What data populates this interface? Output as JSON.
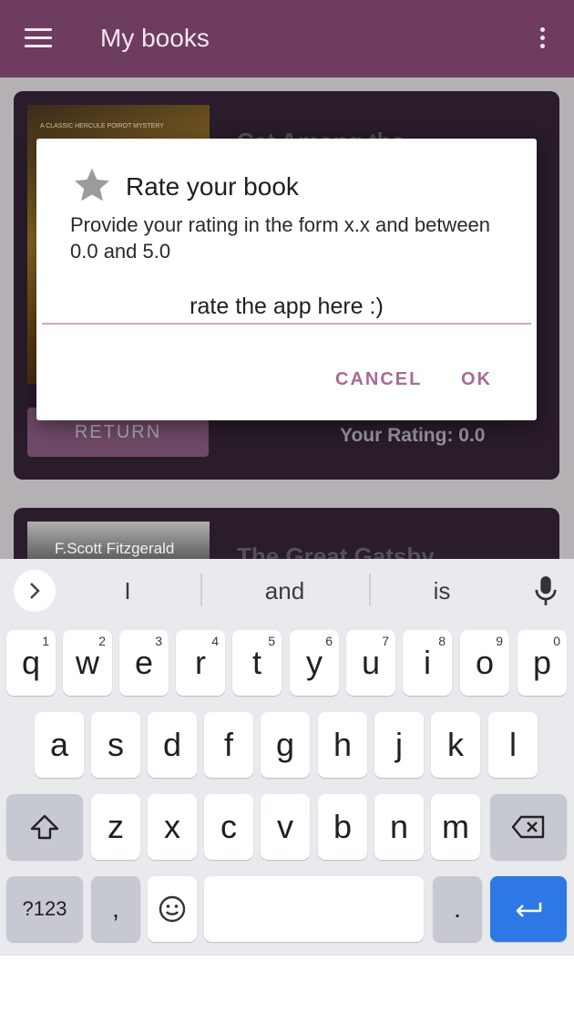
{
  "app_bar": {
    "title": "My books"
  },
  "books": [
    {
      "title": "Cat Among the",
      "cover_tag": "A CLASSIC HERCULE POIROT MYSTERY",
      "return_label": "RETURN",
      "rating_text": "Your Rating: 0.0"
    },
    {
      "title": "The Great Gatsby",
      "cover_author": "F.Scott Fitzgerald"
    }
  ],
  "dialog": {
    "icon": "star-icon",
    "title": "Rate your book",
    "message": "Provide your rating in the form x.x and between 0.0 and 5.0",
    "input_placeholder": "rate the app here :)",
    "cancel_label": "CANCEL",
    "ok_label": "OK"
  },
  "keyboard": {
    "suggestions": [
      "I",
      "and",
      "is"
    ],
    "row1": [
      {
        "key": "q",
        "hint": "1"
      },
      {
        "key": "w",
        "hint": "2"
      },
      {
        "key": "e",
        "hint": "3"
      },
      {
        "key": "r",
        "hint": "4"
      },
      {
        "key": "t",
        "hint": "5"
      },
      {
        "key": "y",
        "hint": "6"
      },
      {
        "key": "u",
        "hint": "7"
      },
      {
        "key": "i",
        "hint": "8"
      },
      {
        "key": "o",
        "hint": "9"
      },
      {
        "key": "p",
        "hint": "0"
      }
    ],
    "row2": [
      "a",
      "s",
      "d",
      "f",
      "g",
      "h",
      "j",
      "k",
      "l"
    ],
    "row3": [
      "z",
      "x",
      "c",
      "v",
      "b",
      "n",
      "m"
    ],
    "symbols_label": "?123",
    "comma": ",",
    "period": "."
  },
  "colors": {
    "app_bar": "#6d3c5f",
    "accent": "#a96a98",
    "enter_key": "#2d78e4"
  }
}
